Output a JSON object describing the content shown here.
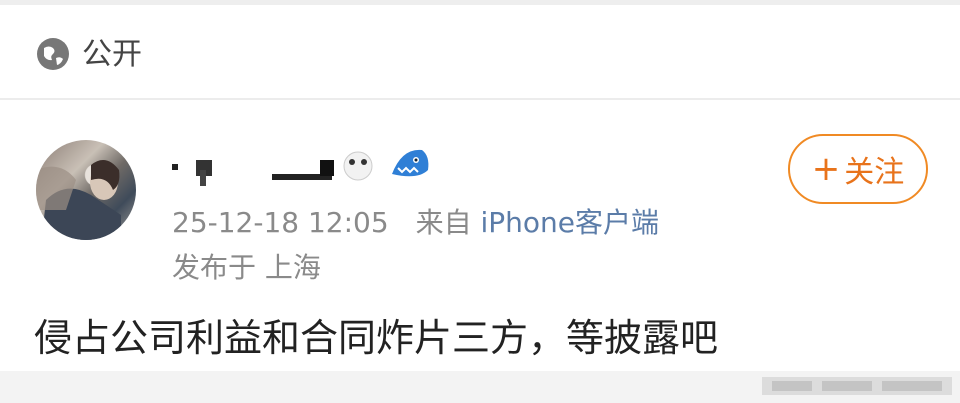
{
  "visibility": {
    "label": "公开",
    "icon": "globe-icon"
  },
  "post": {
    "follow_label": "关注",
    "follow_plus": "+",
    "timestamp": "25-12-18 12:05",
    "source_prefix": "来自",
    "source": "iPhone客户端",
    "location": "发布于 上海",
    "text": "侵占公司利益和合同炸片三方，等披露吧",
    "badge_icon": "shark-badge-icon"
  },
  "colors": {
    "accent": "#f08a24",
    "link": "#5b7ca8",
    "meta_text": "#8a8a8a"
  }
}
